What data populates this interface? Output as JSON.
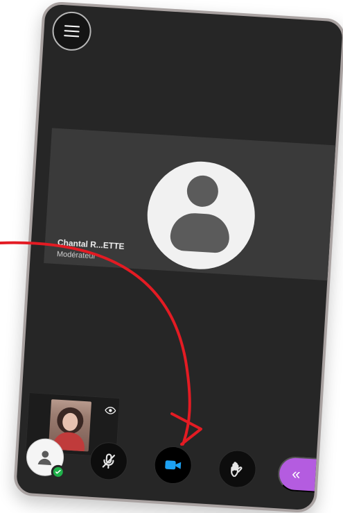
{
  "app": {
    "background": "#262626",
    "frame_border": "#a9a2a1"
  },
  "participant": {
    "name": "Chantal R...ETTE",
    "role": "Modérateur"
  },
  "toolbar": {
    "user_icon": "user-icon",
    "user_status_icon": "check-icon",
    "mic_icon": "mic-muted-icon",
    "camera_icon": "video-camera-icon",
    "raise_hand_icon": "hand-icon",
    "drawer_label": "«",
    "accent_camera": "#1da1f2",
    "accent_drawer": "#b45ce0",
    "status_green": "#1fb14a"
  },
  "self_view": {
    "visibility_icon": "eye-icon"
  },
  "annotation": {
    "arrow_color": "#e31b23"
  }
}
